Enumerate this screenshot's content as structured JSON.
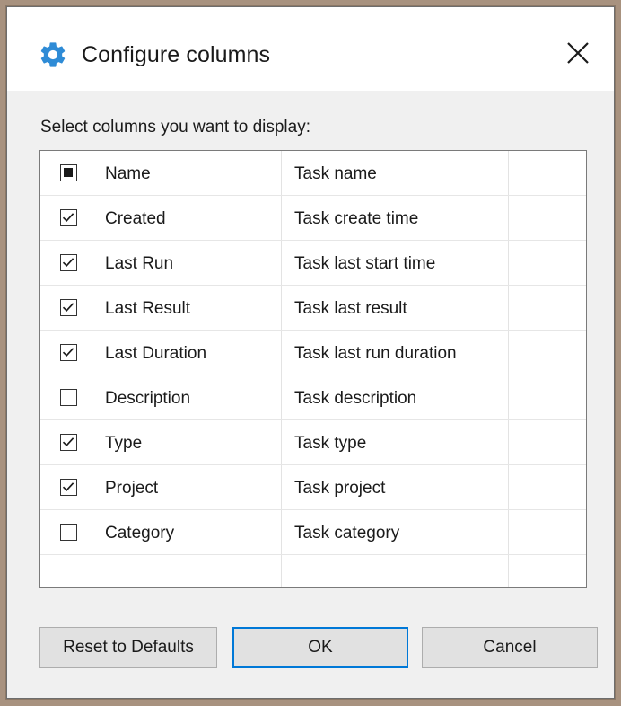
{
  "dialog": {
    "title": "Configure columns",
    "title_icon": "gear-icon",
    "close_icon": "close-icon",
    "prompt": "Select columns you want to display:",
    "accent_color": "#0078d7",
    "icon_color": "#2e8bd6"
  },
  "columns": [
    {
      "name": "Name",
      "description": "Task name",
      "state": "indeterminate"
    },
    {
      "name": "Created",
      "description": "Task create time",
      "state": "checked"
    },
    {
      "name": "Last Run",
      "description": "Task last start time",
      "state": "checked"
    },
    {
      "name": "Last Result",
      "description": "Task last result",
      "state": "checked"
    },
    {
      "name": "Last Duration",
      "description": "Task last run duration",
      "state": "checked"
    },
    {
      "name": "Description",
      "description": "Task description",
      "state": "unchecked"
    },
    {
      "name": "Type",
      "description": "Task type",
      "state": "checked"
    },
    {
      "name": "Project",
      "description": "Task project",
      "state": "checked"
    },
    {
      "name": "Category",
      "description": "Task category",
      "state": "unchecked"
    }
  ],
  "buttons": {
    "reset": "Reset to Defaults",
    "ok": "OK",
    "cancel": "Cancel"
  }
}
